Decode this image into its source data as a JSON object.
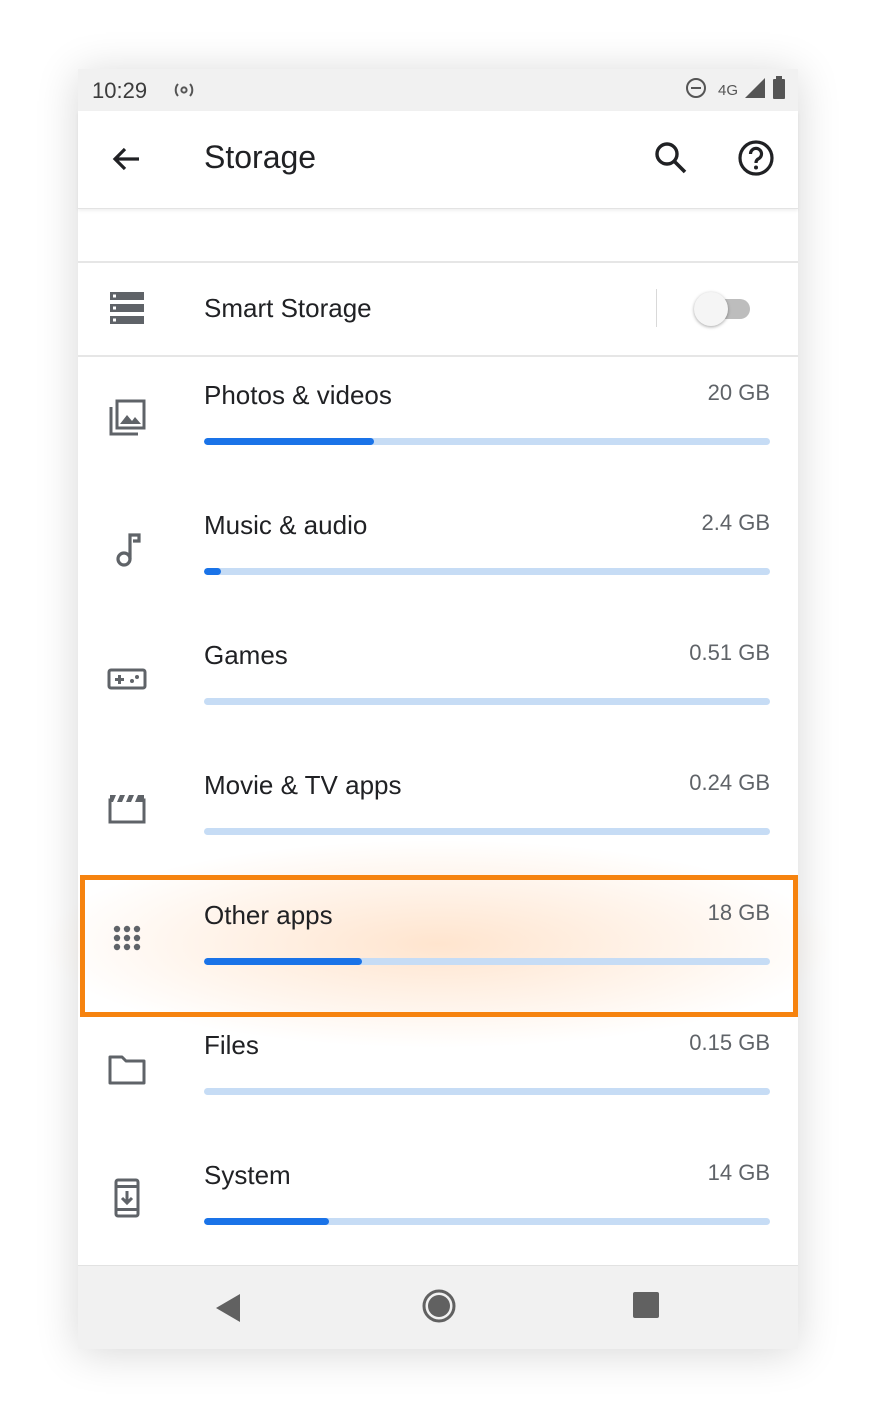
{
  "status_bar": {
    "time": "10:29",
    "network": "4G",
    "icons": [
      "hotspot-icon",
      "do-not-disturb-icon",
      "signal-icon",
      "battery-icon"
    ]
  },
  "app_bar": {
    "title": "Storage",
    "back_icon": "arrow-back-icon",
    "search_icon": "search-icon",
    "help_icon": "help-icon"
  },
  "smart_storage": {
    "label": "Smart Storage",
    "icon": "storage-icon",
    "enabled": false
  },
  "categories": [
    {
      "label": "Photos & videos",
      "size": "20 GB",
      "icon": "photo-library-icon",
      "fill": 0.3
    },
    {
      "label": "Music & audio",
      "size": "2.4 GB",
      "icon": "music-note-icon",
      "fill": 0.03
    },
    {
      "label": "Games",
      "size": "0.51 GB",
      "icon": "gamepad-icon",
      "fill": 0.0
    },
    {
      "label": "Movie & TV apps",
      "size": "0.24 GB",
      "icon": "movie-icon",
      "fill": 0.0
    },
    {
      "label": "Other apps",
      "size": "18 GB",
      "icon": "apps-grid-icon",
      "fill": 0.28
    },
    {
      "label": "Files",
      "size": "0.15 GB",
      "icon": "folder-icon",
      "fill": 0.0
    },
    {
      "label": "System",
      "size": "14 GB",
      "icon": "system-update-icon",
      "fill": 0.22
    }
  ],
  "highlighted_category": "Other apps",
  "colors": {
    "accent": "#1a73e8",
    "bar_track": "#c6dcf5",
    "highlight": "#f6830f",
    "icon": "#5f6368"
  },
  "nav_bar": {
    "back_icon": "nav-back-icon",
    "home_icon": "nav-home-icon",
    "recents_icon": "nav-recents-icon"
  }
}
